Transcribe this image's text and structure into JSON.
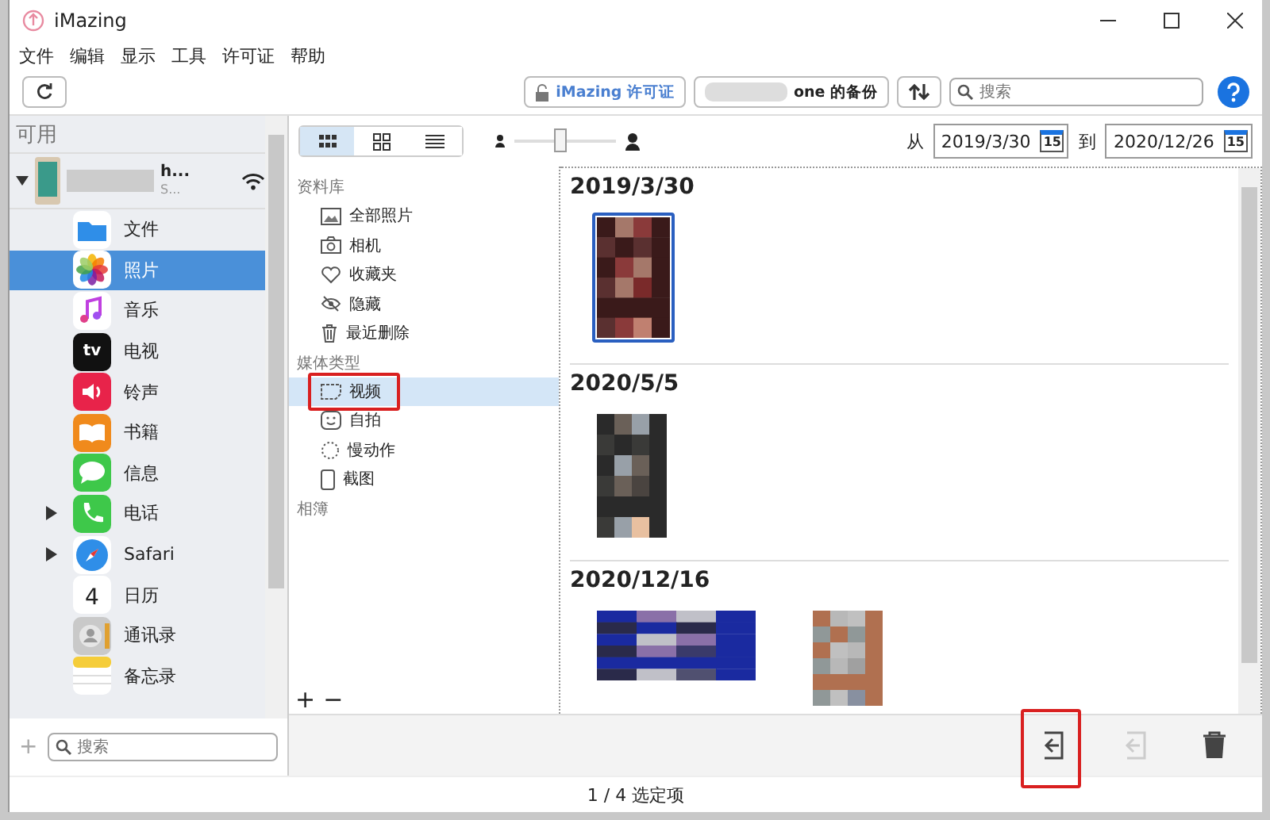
{
  "window": {
    "title": "iMazing"
  },
  "menu": [
    "文件",
    "编辑",
    "显示",
    "工具",
    "许可证",
    "帮助"
  ],
  "toolbar": {
    "license_button": "iMazing 许可证",
    "backup_button": "one 的备份",
    "search": {
      "placeholder": "搜索"
    }
  },
  "sidebar": {
    "header": "可用",
    "device": {
      "name": "h...",
      "subtitle": "S...",
      "expanded": true
    },
    "items": [
      {
        "label": "文件",
        "kind": "files",
        "selected": false,
        "expandable": false
      },
      {
        "label": "照片",
        "kind": "photos",
        "selected": true,
        "expandable": false
      },
      {
        "label": "音乐",
        "kind": "music",
        "selected": false,
        "expandable": false
      },
      {
        "label": "电视",
        "kind": "tv",
        "icon_text": "tv",
        "selected": false,
        "expandable": false
      },
      {
        "label": "铃声",
        "kind": "ringtones",
        "selected": false,
        "expandable": false
      },
      {
        "label": "书籍",
        "kind": "books",
        "selected": false,
        "expandable": false
      },
      {
        "label": "信息",
        "kind": "messages",
        "selected": false,
        "expandable": false
      },
      {
        "label": "电话",
        "kind": "phone",
        "selected": false,
        "expandable": true
      },
      {
        "label": "Safari",
        "kind": "safari",
        "selected": false,
        "expandable": true
      },
      {
        "label": "日历",
        "kind": "calendar",
        "icon_text": "4",
        "selected": false,
        "expandable": false
      },
      {
        "label": "通讯录",
        "kind": "contacts",
        "selected": false,
        "expandable": false
      },
      {
        "label": "备忘录",
        "kind": "notes",
        "selected": false,
        "expandable": false
      }
    ],
    "add_button": "+",
    "search": {
      "placeholder": "搜索"
    }
  },
  "view_modes": [
    {
      "kind": "small-grid",
      "selected": true
    },
    {
      "kind": "large-grid",
      "selected": false
    },
    {
      "kind": "list",
      "selected": false
    }
  ],
  "zoom": {
    "level": 0.45
  },
  "date_range": {
    "from_label": "从",
    "from": "2019/3/30",
    "to_label": "到",
    "to": "2020/12/26",
    "from_calendar_day": "15",
    "to_calendar_day": "15"
  },
  "library": [
    {
      "title": "资料库",
      "items": [
        {
          "label": "全部照片",
          "kind": "photos",
          "selected": false,
          "highlighted": false
        },
        {
          "label": "相机",
          "kind": "camera",
          "selected": false,
          "highlighted": false
        },
        {
          "label": "收藏夹",
          "kind": "heart",
          "selected": false,
          "highlighted": false
        },
        {
          "label": "隐藏",
          "kind": "hidden",
          "selected": false,
          "highlighted": false
        },
        {
          "label": "最近删除",
          "kind": "trash",
          "selected": false,
          "highlighted": false
        }
      ]
    },
    {
      "title": "媒体类型",
      "items": [
        {
          "label": "视频",
          "kind": "video",
          "selected": true,
          "highlighted": true
        },
        {
          "label": "自拍",
          "kind": "selfie",
          "selected": false,
          "highlighted": false
        },
        {
          "label": "慢动作",
          "kind": "slowmo",
          "selected": false,
          "highlighted": false
        },
        {
          "label": "截图",
          "kind": "screenshot",
          "selected": false,
          "highlighted": false
        }
      ]
    },
    {
      "title": "相簿"
    }
  ],
  "library_buttons": [
    "+",
    "−"
  ],
  "groups": [
    {
      "date": "2019/3/30",
      "photos": [
        {
          "kind": "picture",
          "selected": true
        }
      ]
    },
    {
      "date": "2020/5/5",
      "photos": [
        {
          "kind": "picture",
          "selected": false
        }
      ]
    },
    {
      "date": "2020/12/16",
      "photos": [
        {
          "kind": "picture",
          "selected": false
        },
        {
          "kind": "picture",
          "selected": false
        }
      ]
    }
  ],
  "actions": [
    {
      "kind": "import",
      "disabled": false,
      "highlighted": true
    },
    {
      "kind": "export",
      "disabled": true,
      "highlighted": false
    },
    {
      "kind": "delete",
      "disabled": false,
      "highlighted": false
    }
  ],
  "status": "1 / 4 选定项"
}
